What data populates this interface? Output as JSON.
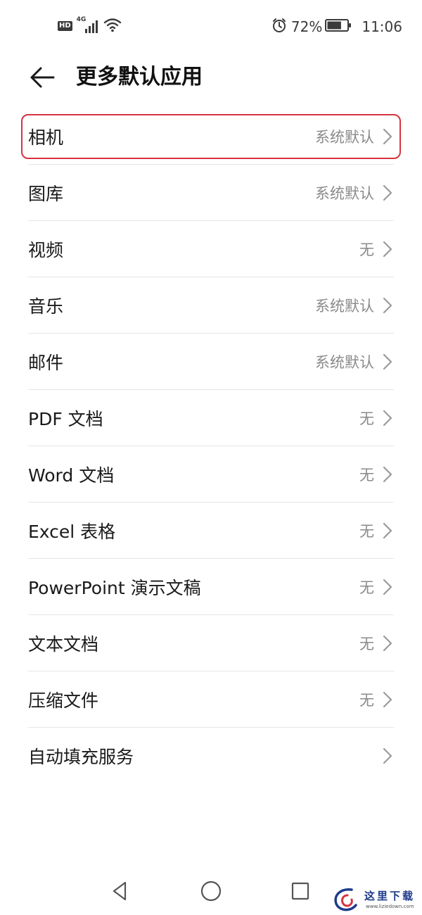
{
  "status_bar": {
    "hd_badge": "HD",
    "network_type": "4G",
    "battery_percent": "72%",
    "battery_level": 0.72,
    "time": "11:06",
    "icons": [
      "signal-icon",
      "wifi-icon",
      "alarm-icon",
      "battery-icon"
    ]
  },
  "header": {
    "title": "更多默认应用",
    "back_icon": "back-arrow-icon"
  },
  "list": {
    "items": [
      {
        "label": "相机",
        "value": "系统默认"
      },
      {
        "label": "图库",
        "value": "系统默认"
      },
      {
        "label": "视频",
        "value": "无"
      },
      {
        "label": "音乐",
        "value": "系统默认"
      },
      {
        "label": "邮件",
        "value": "系统默认"
      },
      {
        "label": "PDF 文档",
        "value": "无"
      },
      {
        "label": "Word 文档",
        "value": "无"
      },
      {
        "label": "Excel 表格",
        "value": "无"
      },
      {
        "label": "PowerPoint 演示文稿",
        "value": "无"
      },
      {
        "label": "文本文档",
        "value": "无"
      },
      {
        "label": "压缩文件",
        "value": "无"
      },
      {
        "label": "自动填充服务",
        "value": ""
      }
    ],
    "highlight_color": "#d6333f"
  },
  "nav_bar": {
    "icons": [
      "back-triangle-icon",
      "home-circle-icon",
      "recents-square-icon"
    ]
  },
  "watermark": {
    "text": "这里下载",
    "url": "www.liziedown.com"
  }
}
